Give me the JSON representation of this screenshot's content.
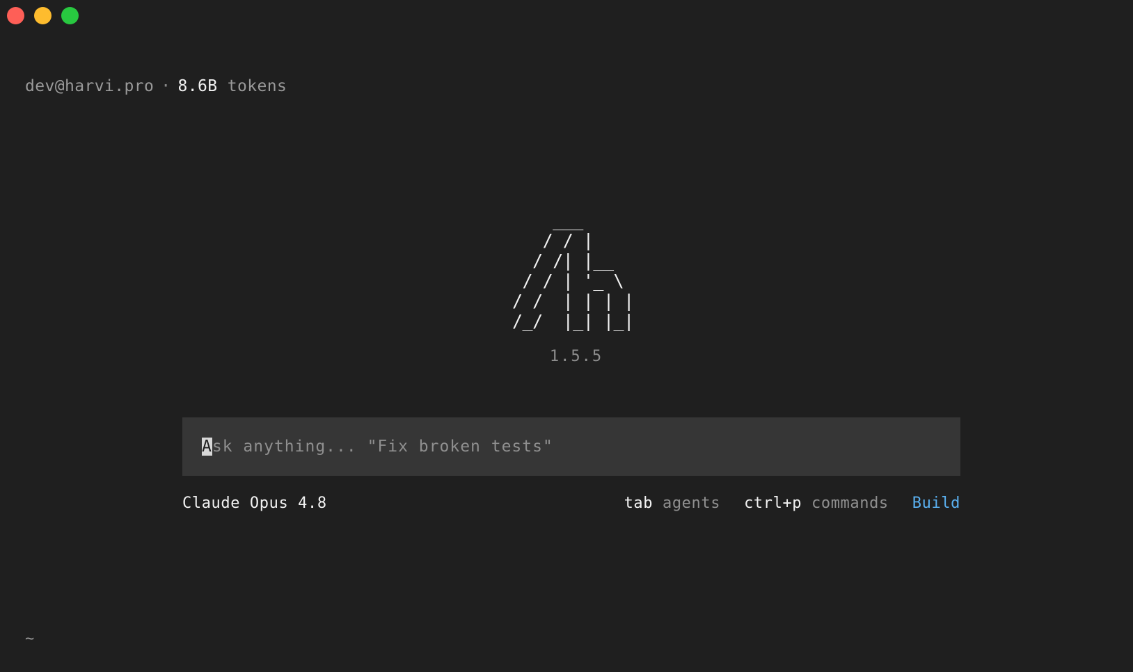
{
  "window": {
    "controls": [
      {
        "name": "close",
        "color": "#fe5f57"
      },
      {
        "name": "minimize",
        "color": "#febc2e"
      },
      {
        "name": "maximize",
        "color": "#28c840"
      }
    ]
  },
  "header": {
    "account": "dev@harvi.pro",
    "separator": "·",
    "token_count": "8.6B",
    "token_label": "tokens"
  },
  "logo": {
    "ascii": "    ___\n   / / |\n  / /| |__\n / / | '_ \\\n/ /  | | | |\n/_/  |_| |_|",
    "version": "1.5.5"
  },
  "prompt": {
    "cursor_char": "A",
    "placeholder_rest": "sk anything... \"Fix broken tests\""
  },
  "statusbar": {
    "model": "Claude Opus 4.8",
    "hints": [
      {
        "key": "tab",
        "desc": "agents"
      },
      {
        "key": "ctrl+p",
        "desc": "commands"
      }
    ],
    "mode": "Build"
  },
  "footer": {
    "tilde": "~"
  }
}
